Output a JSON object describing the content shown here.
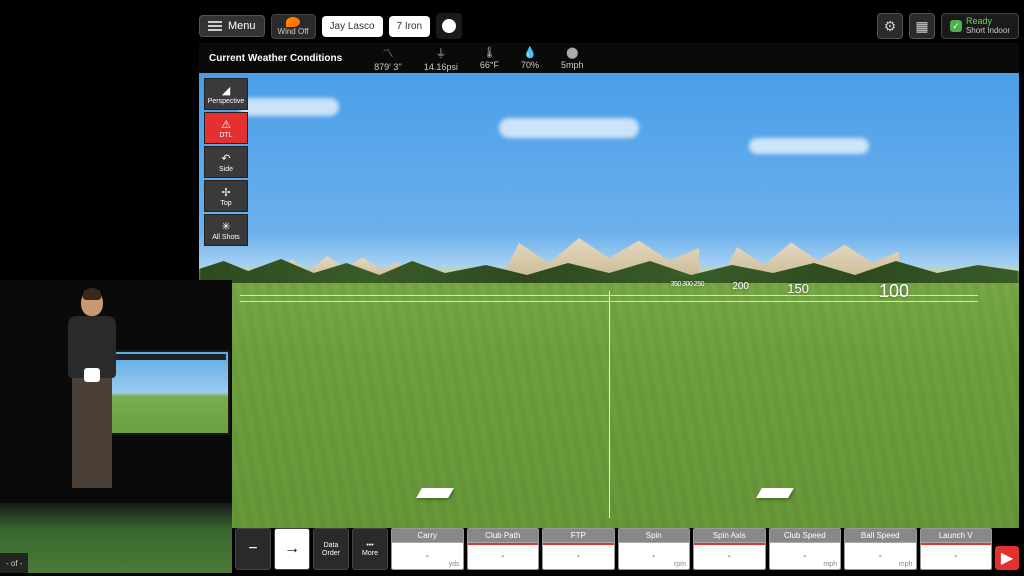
{
  "topbar": {
    "menu": "Menu",
    "wind": "Wind Off",
    "player": "Jay Lasco",
    "club": "7 Iron",
    "ready": "Ready",
    "ready_sub": "Short Indoor"
  },
  "weather": {
    "title": "Current Weather Conditions",
    "elevation": "879' 3''",
    "pressure": "14.16psi",
    "temp": "66°F",
    "humidity": "70%",
    "wind": "5mph"
  },
  "views": {
    "perspective": "Perspective",
    "dtl": "DTL",
    "side": "Side",
    "top": "Top",
    "all": "All Shots"
  },
  "distances": {
    "d100": "100",
    "d150": "150",
    "d200": "200",
    "dsmall": "350 300 250"
  },
  "bottom": {
    "minus": "−",
    "arrow": "→",
    "data_order_l1": "Data",
    "data_order_l2": "Order",
    "more_l1": "•••",
    "more_l2": "More"
  },
  "metrics": [
    {
      "label": "Carry",
      "value": "-",
      "unit": "yds",
      "red": false
    },
    {
      "label": "Club Path",
      "value": "-",
      "unit": "",
      "red": true
    },
    {
      "label": "FTP",
      "value": "-",
      "unit": "",
      "red": true
    },
    {
      "label": "Spin",
      "value": "-",
      "unit": "rpm",
      "red": false
    },
    {
      "label": "Spin Axis",
      "value": "-",
      "unit": "",
      "red": true
    },
    {
      "label": "Club Speed",
      "value": "-",
      "unit": "mph",
      "red": false
    },
    {
      "label": "Ball Speed",
      "value": "-",
      "unit": "mph",
      "red": false
    },
    {
      "label": "Launch V",
      "value": "-",
      "unit": "",
      "red": true
    }
  ],
  "pip": {
    "page": "- of -"
  }
}
